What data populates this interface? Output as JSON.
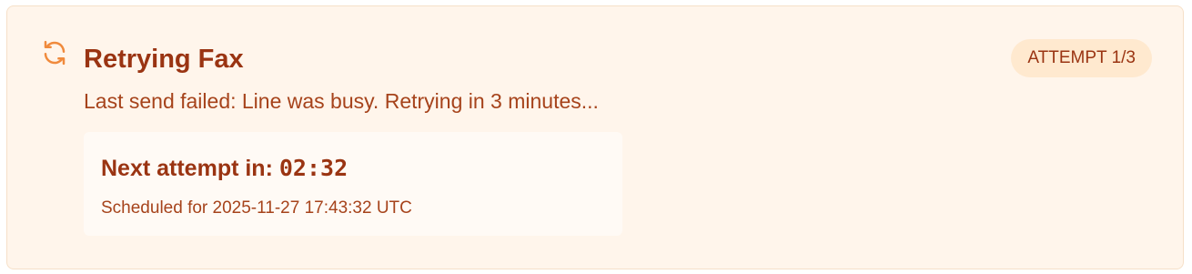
{
  "notice": {
    "title": "Retrying Fax",
    "icon": "refresh-icon",
    "accent_color": "#f08a3c",
    "text_color": "#9a3412",
    "background_color": "#fff5eb",
    "attempt_badge": "ATTEMPT 1/3",
    "message": "Last send failed: Line was busy. Retrying in 3 minutes...",
    "countdown": {
      "label": "Next attempt in:",
      "time": "02:32",
      "scheduled": "Scheduled for 2025-11-27 17:43:32 UTC"
    }
  }
}
